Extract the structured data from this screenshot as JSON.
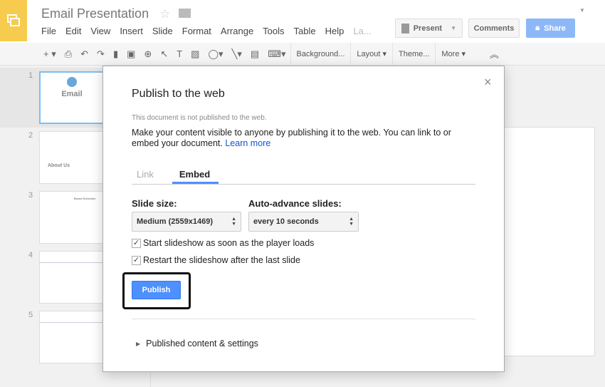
{
  "header": {
    "title": "Email Presentation",
    "menu": [
      "File",
      "Edit",
      "View",
      "Insert",
      "Slide",
      "Format",
      "Arrange",
      "Tools",
      "Table",
      "Help",
      "La..."
    ],
    "present": "Present",
    "comments": "Comments",
    "share": "Share"
  },
  "toolbar": {
    "background": "Background...",
    "layout": "Layout",
    "theme": "Theme...",
    "more": "More"
  },
  "filmstrip": {
    "slides": [
      {
        "num": "1",
        "title": "Email"
      },
      {
        "num": "2",
        "title": "About Us"
      },
      {
        "num": "3",
        "title": "Board Schedule"
      },
      {
        "num": "4",
        "title": ""
      },
      {
        "num": "5",
        "title": ""
      }
    ]
  },
  "dialog": {
    "title": "Publish to the web",
    "close": "×",
    "note": "This document is not published to the web.",
    "description": "Make your content visible to anyone by publishing it to the web. You can link to or embed your document.",
    "learn_more": "Learn more",
    "tabs": [
      "Link",
      "Embed"
    ],
    "slide_size_label": "Slide size:",
    "slide_size_value": "Medium (2559x1469)",
    "auto_advance_label": "Auto-advance slides:",
    "auto_advance_value": "every 10 seconds",
    "checkbox1": "Start slideshow as soon as the player loads",
    "checkbox2": "Restart the slideshow after the last slide",
    "publish": "Publish",
    "published_settings": "Published content & settings"
  },
  "colors": {
    "accent": "#4d90fe",
    "logo": "#f7cb4d"
  }
}
